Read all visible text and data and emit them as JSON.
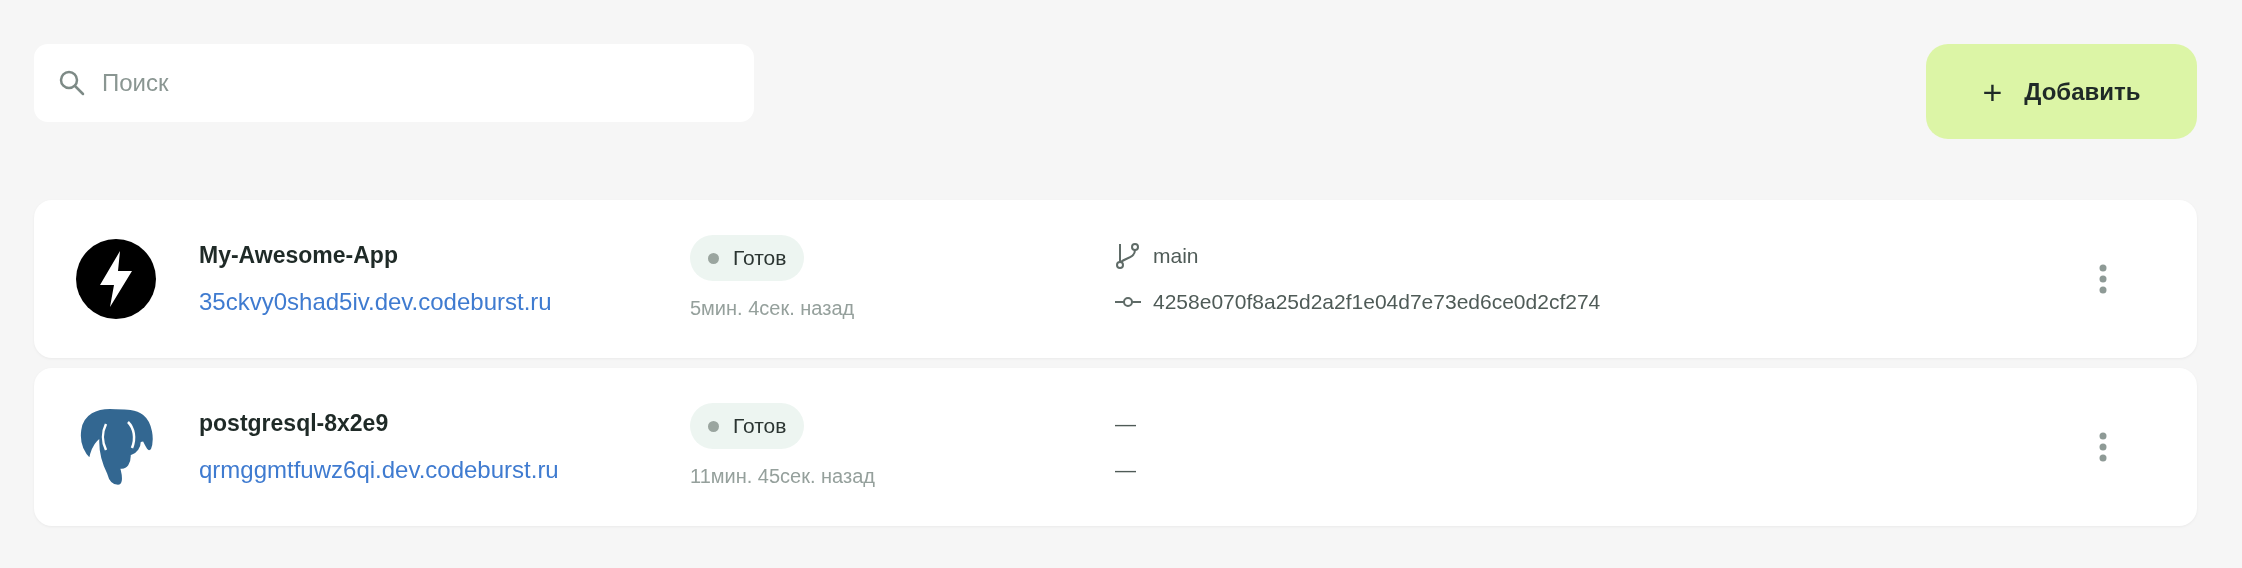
{
  "search": {
    "placeholder": "Поиск"
  },
  "add_button": {
    "icon": "+",
    "label": "Добавить"
  },
  "services": [
    {
      "kind": "bolt",
      "name": "My-Awesome-App",
      "domain": "35ckvy0shad5iv.dev.codeburst.ru",
      "status": {
        "label": "Готов",
        "color": "#9aa59f"
      },
      "updated": "5мин. 4сек. назад",
      "git": {
        "icons": true,
        "branch": "main",
        "commit": "4258e070f8a25d2a2f1e04d7e73ed6ce0d2cf274"
      }
    },
    {
      "kind": "elephant",
      "name": "postgresql-8x2e9",
      "domain": "qrmggmtfuwz6qi.dev.codeburst.ru",
      "status": {
        "label": "Готов",
        "color": "#9aa59f"
      },
      "updated": "11мин. 45сек. назад",
      "git": {
        "icons": false,
        "branch": "—",
        "commit": "—"
      }
    }
  ]
}
